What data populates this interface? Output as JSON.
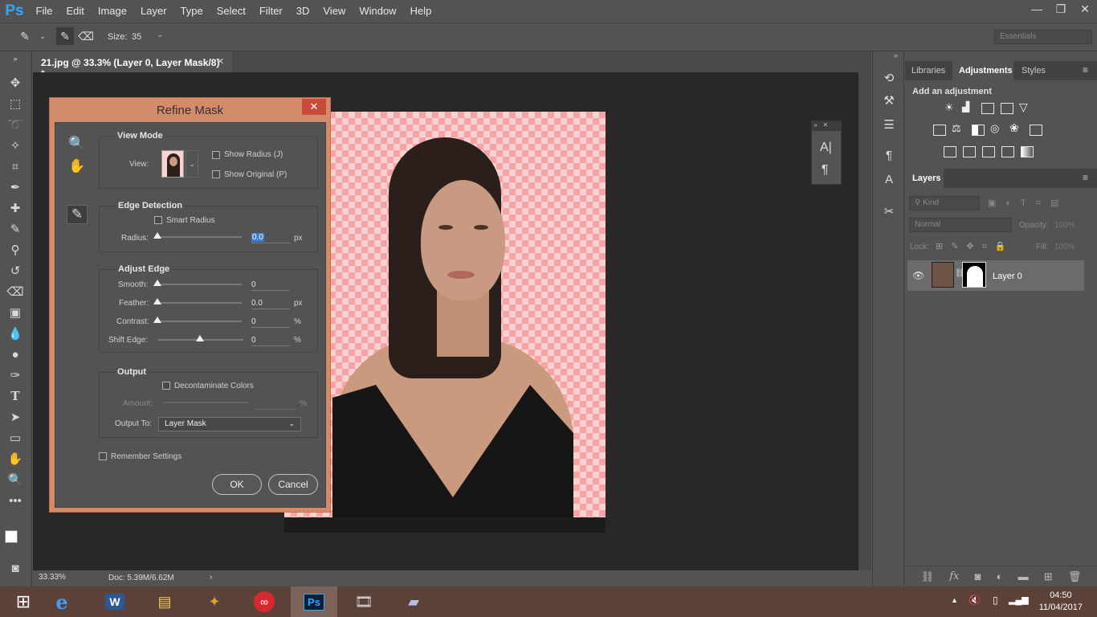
{
  "app": {
    "logo": "Ps"
  },
  "menu": [
    "File",
    "Edit",
    "Image",
    "Layer",
    "Type",
    "Select",
    "Filter",
    "3D",
    "View",
    "Window",
    "Help"
  ],
  "options": {
    "size_label": "Size:",
    "size_value": "35",
    "workspace": "Essentials"
  },
  "document": {
    "tab_title": "21.jpg @ 33.3% (Layer 0, Layer Mask/8) *",
    "zoom": "33.33%",
    "doc_info": "Doc: 5.39M/6.62M"
  },
  "dialog": {
    "title": "Refine Mask",
    "view_mode": {
      "heading": "View Mode",
      "view_label": "View:",
      "show_radius": "Show Radius (J)",
      "show_original": "Show Original (P)"
    },
    "edge_detection": {
      "heading": "Edge Detection",
      "smart_radius": "Smart Radius",
      "radius_label": "Radius:",
      "radius_value": "0.0",
      "radius_unit": "px"
    },
    "adjust_edge": {
      "heading": "Adjust Edge",
      "smooth_label": "Smooth:",
      "smooth_value": "0",
      "feather_label": "Feather:",
      "feather_value": "0.0",
      "feather_unit": "px",
      "contrast_label": "Contrast:",
      "contrast_value": "0",
      "contrast_unit": "%",
      "shift_label": "Shift Edge:",
      "shift_value": "0",
      "shift_unit": "%"
    },
    "output": {
      "heading": "Output",
      "decontaminate": "Decontaminate Colors",
      "amount_label": "Amount:",
      "amount_unit": "%",
      "output_to_label": "Output To:",
      "output_to_value": "Layer Mask"
    },
    "remember": "Remember Settings",
    "ok": "OK",
    "cancel": "Cancel"
  },
  "panels": {
    "tabs": [
      "Libraries",
      "Adjustments",
      "Styles"
    ],
    "add_adjustment": "Add an adjustment",
    "layers_tab": "Layers",
    "kind": "Kind",
    "blend_mode": "Normal",
    "opacity_label": "Opacity:",
    "opacity_value": "100%",
    "lock_label": "Lock:",
    "fill_label": "Fill:",
    "fill_value": "100%",
    "layer_name": "Layer 0"
  },
  "taskbar": {
    "time": "04:50",
    "date": "11/04/2017"
  }
}
